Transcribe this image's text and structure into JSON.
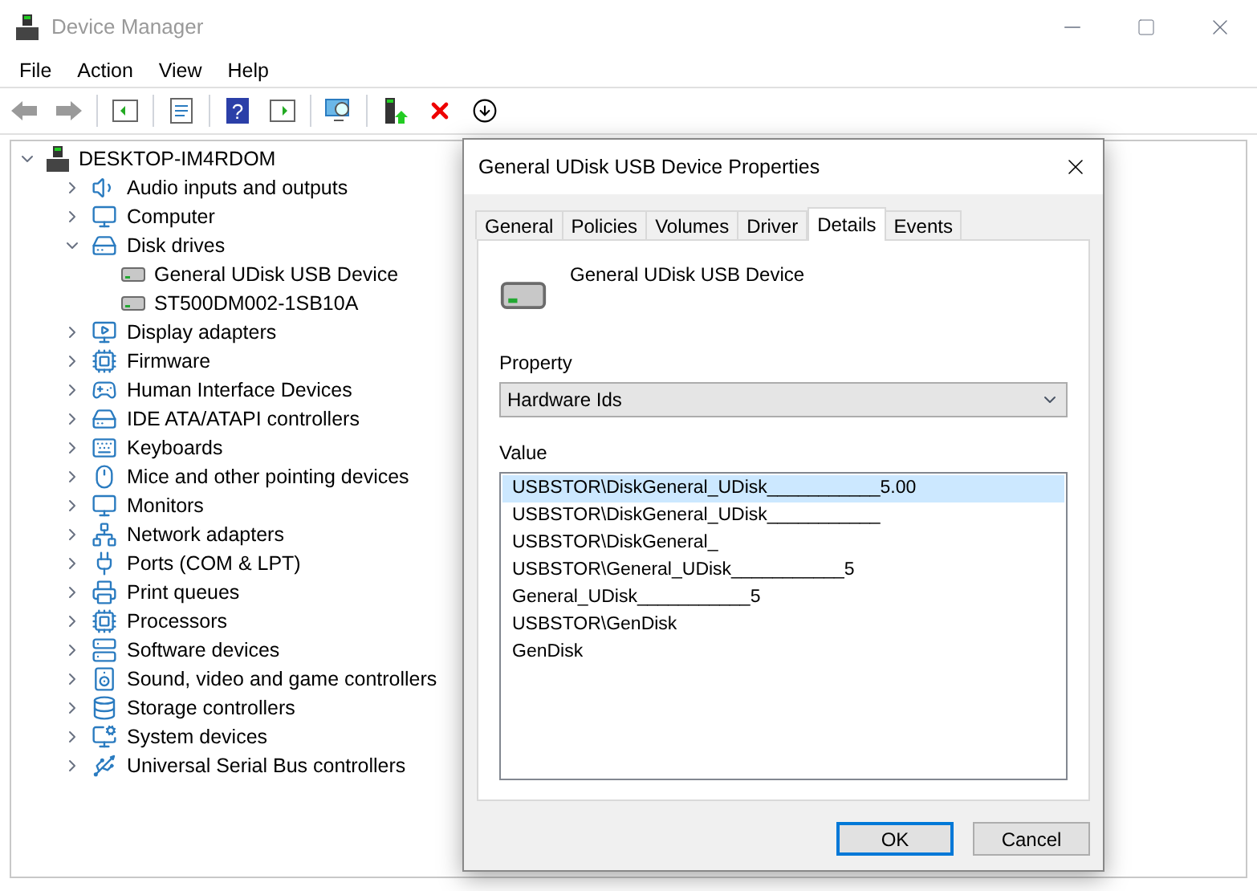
{
  "window": {
    "title": "Device Manager"
  },
  "menu": [
    "File",
    "Action",
    "View",
    "Help"
  ],
  "toolbar": {
    "help_glyph": "?"
  },
  "tree": {
    "label": "DESKTOP-IM4RDOM",
    "expanded": true,
    "children": [
      {
        "label": "Audio inputs and outputs",
        "expanded": false
      },
      {
        "label": "Computer",
        "expanded": false
      },
      {
        "label": "Disk drives",
        "expanded": true,
        "children": [
          {
            "label": "General UDisk USB Device"
          },
          {
            "label": "ST500DM002-1SB10A"
          }
        ]
      },
      {
        "label": "Display adapters",
        "expanded": false
      },
      {
        "label": "Firmware",
        "expanded": false
      },
      {
        "label": "Human Interface Devices",
        "expanded": false
      },
      {
        "label": "IDE ATA/ATAPI controllers",
        "expanded": false
      },
      {
        "label": "Keyboards",
        "expanded": false
      },
      {
        "label": "Mice and other pointing devices",
        "expanded": false
      },
      {
        "label": "Monitors",
        "expanded": false
      },
      {
        "label": "Network adapters",
        "expanded": false
      },
      {
        "label": "Ports (COM & LPT)",
        "expanded": false
      },
      {
        "label": "Print queues",
        "expanded": false
      },
      {
        "label": "Processors",
        "expanded": false
      },
      {
        "label": "Software devices",
        "expanded": false
      },
      {
        "label": "Sound, video and game controllers",
        "expanded": false
      },
      {
        "label": "Storage controllers",
        "expanded": false
      },
      {
        "label": "System devices",
        "expanded": false
      },
      {
        "label": "Universal Serial Bus controllers",
        "expanded": false
      }
    ]
  },
  "dialog": {
    "title": "General UDisk USB Device Properties",
    "tabs": [
      {
        "label": "General",
        "selected": false
      },
      {
        "label": "Policies",
        "selected": false
      },
      {
        "label": "Volumes",
        "selected": false
      },
      {
        "label": "Driver",
        "selected": false
      },
      {
        "label": "Details",
        "selected": true
      },
      {
        "label": "Events",
        "selected": false
      }
    ],
    "device_name": "General UDisk USB Device",
    "property_label": "Property",
    "property_value": "Hardware Ids",
    "value_label": "Value",
    "values": [
      {
        "text": "USBSTOR\\DiskGeneral_UDisk___________5.00",
        "selected": true
      },
      {
        "text": "USBSTOR\\DiskGeneral_UDisk___________",
        "selected": false
      },
      {
        "text": "USBSTOR\\DiskGeneral_",
        "selected": false
      },
      {
        "text": "USBSTOR\\General_UDisk___________5",
        "selected": false
      },
      {
        "text": "General_UDisk___________5",
        "selected": false
      },
      {
        "text": "USBSTOR\\GenDisk",
        "selected": false
      },
      {
        "text": "GenDisk",
        "selected": false
      }
    ],
    "buttons": [
      "OK",
      "Cancel"
    ]
  }
}
